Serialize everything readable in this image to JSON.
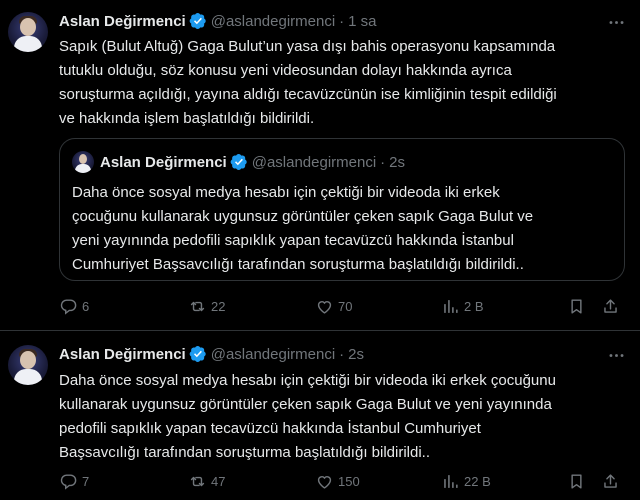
{
  "tweets": [
    {
      "author": "Aslan Değirmenci",
      "handle": "@aslandegirmenci",
      "separator": "·",
      "time": "1 sa",
      "lines": [
        "Sapık (Bulut Altuğ) Gaga Bulut’un yasa dışı bahis operasyonu kapsamında",
        "tutuklu olduğu, söz konusu yeni videosundan dolayı hakkında ayrıca",
        "soruşturma açıldığı, yayına aldığı tecavüzcünün ise kimliğinin tespit edildiği",
        "ve hakkında işlem başlatıldığı bildirildi."
      ],
      "quote": {
        "author": "Aslan Değirmenci",
        "handle": "@aslandegirmenci",
        "separator": "·",
        "time": "2s",
        "lines": [
          "Daha önce sosyal medya hesabı için çektiği bir videoda iki erkek",
          "çocuğunu kullanarak uygunsuz görüntüler çeken sapık Gaga Bulut ve",
          "yeni yayınında pedofili sapıklık yapan tecavüzcü hakkında İstanbul",
          "Cumhuriyet Başsavcılığı tarafından soruşturma başlatıldığı bildirildi.."
        ]
      },
      "stats": {
        "replies": "6",
        "reposts": "22",
        "likes": "70",
        "views": "2 B"
      }
    },
    {
      "author": "Aslan Değirmenci",
      "handle": "@aslandegirmenci",
      "separator": "·",
      "time": "2s",
      "lines": [
        "Daha önce sosyal medya hesabı için çektiği bir videoda iki erkek çocuğunu",
        "kullanarak uygunsuz görüntüler çeken sapık Gaga Bulut ve yeni yayınında",
        "pedofili sapıklık yapan tecavüzcü hakkında İstanbul Cumhuriyet",
        "Başsavcılığı tarafından soruşturma başlatıldığı bildirildi.."
      ],
      "stats": {
        "replies": "7",
        "reposts": "47",
        "likes": "150",
        "views": "22 B"
      }
    }
  ],
  "colors": {
    "background": "#000000",
    "text": "#e7e9ea",
    "muted": "#71767b",
    "border": "#2f3336",
    "verified": "#1d9bf0"
  },
  "icons": [
    "verified-badge-icon",
    "more-icon",
    "reply-icon",
    "repost-icon",
    "like-icon",
    "views-icon",
    "bookmark-icon",
    "share-icon"
  ]
}
